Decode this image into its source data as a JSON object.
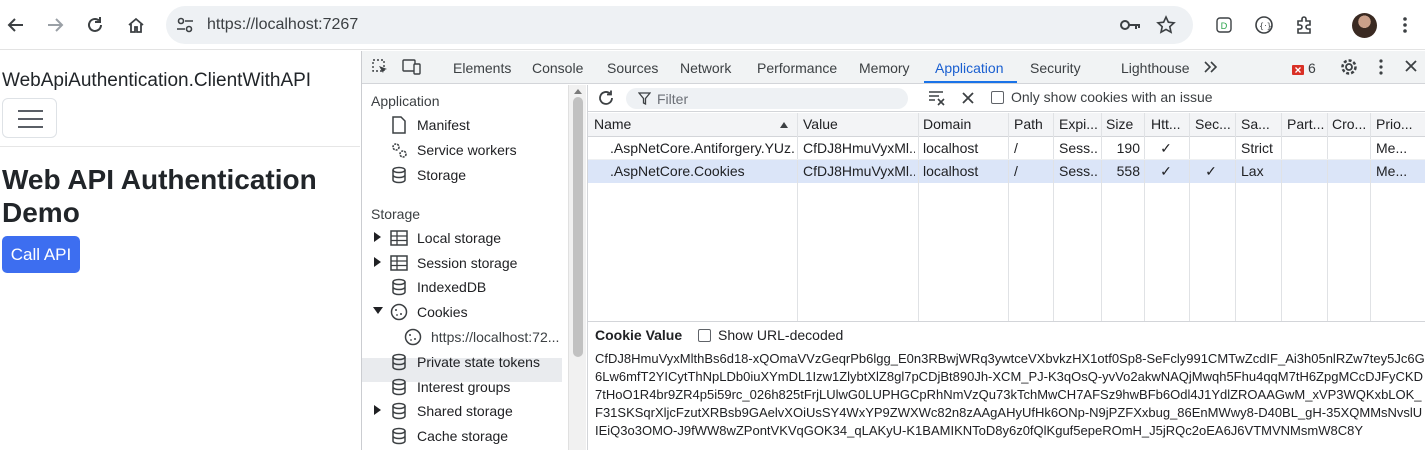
{
  "browser": {
    "url": "https://localhost:7267"
  },
  "page": {
    "brand": "WebApiAuthentication.ClientWithAPI",
    "title": "Web API Authentication Demo",
    "call_api_label": "Call API"
  },
  "devtools": {
    "tabs": [
      "Elements",
      "Console",
      "Sources",
      "Network",
      "Performance",
      "Memory",
      "Application",
      "Security",
      "Lighthouse"
    ],
    "active_tab": "Application",
    "issues_count": "6",
    "sidebar": {
      "application_title": "Application",
      "application_items": [
        "Manifest",
        "Service workers",
        "Storage"
      ],
      "storage_title": "Storage",
      "storage_items": [
        "Local storage",
        "Session storage",
        "IndexedDB",
        "Cookies",
        "https://localhost:72...",
        "Private state tokens",
        "Interest groups",
        "Shared storage",
        "Cache storage"
      ]
    },
    "cookies": {
      "filter_placeholder": "Filter",
      "only_issue_label": "Only show cookies with an issue",
      "columns": [
        "Name",
        "Value",
        "Domain",
        "Path",
        "Expi...",
        "Size",
        "Htt...",
        "Sec...",
        "Sa...",
        "Part...",
        "Cro...",
        "Prio..."
      ],
      "rows": [
        [
          ".AspNetCore.Antiforgery.YUz...",
          "CfDJ8HmuVyxMl...",
          "localhost",
          "/",
          "Sess...",
          "190",
          "✓",
          "",
          "Strict",
          "",
          "",
          "Me..."
        ],
        [
          ".AspNetCore.Cookies",
          "CfDJ8HmuVyxMl...",
          "localhost",
          "/",
          "Sess...",
          "558",
          "✓",
          "✓",
          "Lax",
          "",
          "",
          "Me..."
        ]
      ],
      "selected_row": 1,
      "cookie_value_title": "Cookie Value",
      "show_decoded_label": "Show URL-decoded",
      "cookie_value": "CfDJ8HmuVyxMlthBs6d18-xQOmaVVzGeqrPb6lgg_E0n3RBwjWRq3ywtceVXbvkzHX1otf0Sp8-SeFcly991CMTwZcdIF_Ai3h05nlRZw7tey5Jc6G6Lw6mfT2YICytThNpLDb0iuXYmDL1Izw1ZlybtXlZ8gl7pCDjBt890Jh-XCM_PJ-K3qOsQ-yvVo2akwNAQjMwqh5Fhu4qqM7tH6ZpgMCcDJFyCKD7tHoO1R4br9ZR4p5i59rc_026h825tFrjLUlwG0LUPHGCpRhNmVzQu73kTchMwCH7AFSz9hwBFb6Odl4J1YdlZROAAGwM_xVP3WQKxbLOK_F31SKSqrXljcFzutXRBsb9GAelvXOiUsSY4WxYP9ZWXWc82n8zAAgAHyUfHk6ONp-N9jPZFXxbug_86EnMWwy8-D40BL_gH-35XQMMsNvslUIEiQ3o3OMO-J9fWW8wZPontVKVqGOK34_qLAKyU-K1BAMIKNToD8y6z0fQlKguf5epeROmH_J5jRQc2oEA6J6VTMVNMsmW8C8Y"
    }
  },
  "colors": {
    "accent": "#1a73e8",
    "button": "#3d6ef0",
    "selected_row": "#dbe5f8"
  }
}
